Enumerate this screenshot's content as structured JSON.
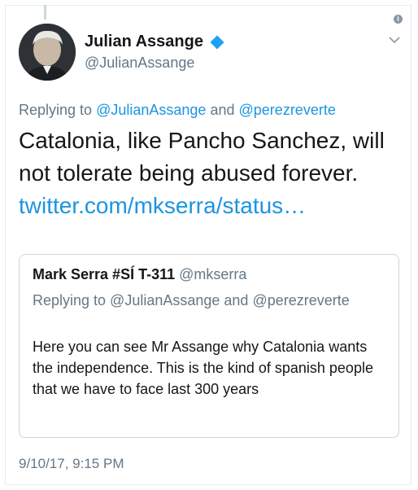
{
  "author": {
    "display_name": "Julian Assange",
    "handle": "@JulianAssange",
    "verified": true
  },
  "reply_context": {
    "prefix": "Replying to",
    "users": [
      "@JulianAssange",
      "@perezreverte"
    ],
    "joiner": "and"
  },
  "tweet": {
    "text": "Catalonia, like Pancho Sanchez, will not tolerate being abused forever.",
    "link": "twitter.com/mkserra/status…",
    "timestamp": "9/10/17, 9:15 PM"
  },
  "quoted_tweet": {
    "display_name": "Mark Serra #SÍ T-311",
    "handle": "@mkserra",
    "replying": "Replying to @JulianAssange and @perezreverte",
    "text": "Here you can see Mr Assange why Catalonia wants the independence. This is the kind of spanish people that we have to face last 300 years"
  },
  "icons": {
    "info": "info-icon",
    "menu": "chevron-down-icon",
    "verified": "verified-badge-icon"
  },
  "colors": {
    "link": "#1b95e0",
    "secondary_text": "#657786",
    "verified": "#1da1f2",
    "border": "#ccd6dd"
  }
}
